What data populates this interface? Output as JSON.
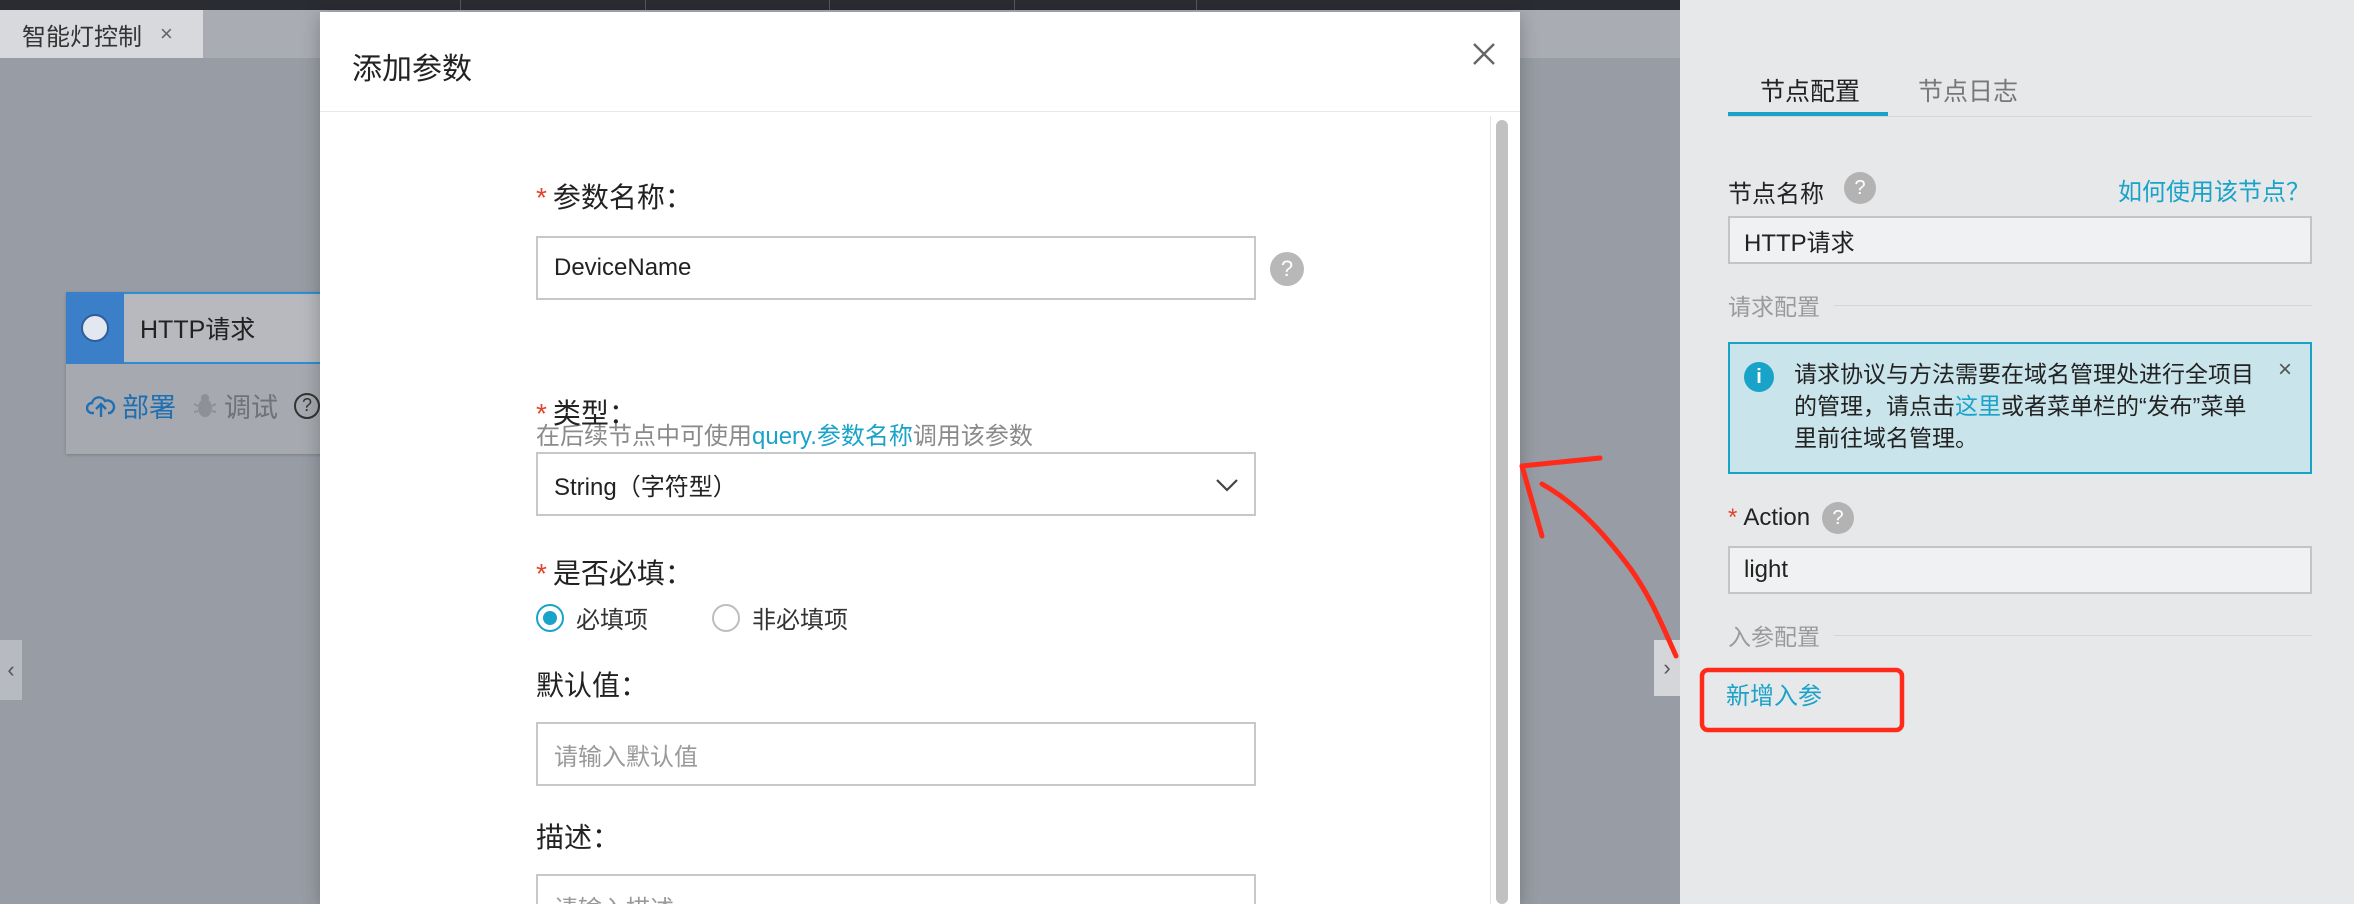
{
  "tab": {
    "title": "智能灯控制",
    "close": "×"
  },
  "node": {
    "title": "HTTP请求",
    "deploy": "部署",
    "debug": "调试",
    "help": "?"
  },
  "collapse": {
    "left": "‹",
    "right": "›"
  },
  "modal": {
    "title": "添加参数",
    "param_name_label": "参数名称：",
    "param_name_value": "DeviceName",
    "help": "?",
    "hint_pre": "在后续节点中可使用",
    "hint_hl": "query.参数名称",
    "hint_post": "调用该参数",
    "type_label": "类型：",
    "type_value": "String（字符型）",
    "required_label": "是否必填：",
    "required_option": "必填项",
    "optional_option": "非必填项",
    "default_label": "默认值：",
    "default_placeholder": "请输入默认值",
    "desc_label": "描述：",
    "desc_placeholder": "请输入描述",
    "required_mark": "*"
  },
  "panel": {
    "tab_config": "节点配置",
    "tab_log": "节点日志",
    "node_name_label": "节点名称",
    "how_to_use": "如何使用该节点？",
    "node_name_value": "HTTP请求",
    "request_config": "请求配置",
    "info_icon": "i",
    "info_pre": "请求协议与方法需要在域名管理处进行全项目的管理，请点击",
    "info_link": "这里",
    "info_post": "或者菜单栏的“发布”菜单里前往域名管理。",
    "info_close": "×",
    "action_label": "Action",
    "action_value": "light",
    "input_config": "入参配置",
    "add_param": "新增入参",
    "required_mark": "*",
    "help": "?"
  },
  "colors": {
    "accent": "#1aa3c9",
    "required": "#e0442a",
    "annotation": "#ff2a1a",
    "node_blue": "#3c7fc9"
  }
}
